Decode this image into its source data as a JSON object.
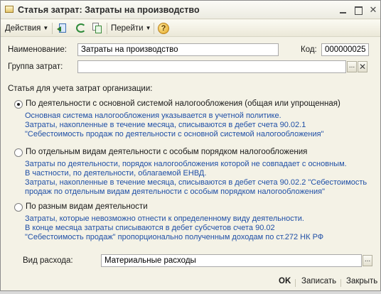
{
  "window": {
    "title": "Статья затрат: Затраты на производство"
  },
  "toolbar": {
    "actions_label": "Действия",
    "goto_label": "Перейти",
    "help_symbol": "?"
  },
  "form": {
    "name_label": "Наименование:",
    "name_value": "Затраты на производство",
    "code_label": "Код:",
    "code_value": "000000025",
    "group_label": "Группа затрат:",
    "group_value": "",
    "section_label": "Статья для учета затрат организации:",
    "select_button": "...",
    "clear_button": "✕"
  },
  "options": [
    {
      "label": "По деятельности с основной системой налогообложения (общая или упрощенная)",
      "selected": true,
      "description": [
        "Основная система налогообложения указывается в учетной политике.",
        "Затраты, накопленные в течение месяца, списываются в дебет счета 90.02.1",
        "\"Себестоимость продаж по деятельности с основной системой налогообложения\""
      ]
    },
    {
      "label": "По отдельным видам деятельности с особым порядком налогообложения",
      "selected": false,
      "description": [
        "Затраты по деятельности, порядок налогообложения которой не совпадает с основным.",
        "В частности, по деятельности, облагаемой ЕНВД.",
        "Затраты, накопленные в течение месяца, списываются в дебет счета 90.02.2 \"Себестоимость",
        "продаж по отдельным видам деятельности с особым порядком налогообложения\""
      ]
    },
    {
      "label": "По разным видам деятельности",
      "selected": false,
      "description": [
        "Затраты, которые невозможно отнести к определенному виду деятельности.",
        "В конце месяца затраты списываются в дебет субсчетов счета 90.02",
        "\"Себестоимость продаж\" пропорционально полученным доходам по ст.272 НК РФ"
      ]
    }
  ],
  "expense": {
    "label": "Вид расхода:",
    "value": "Материальные расходы"
  },
  "footer": {
    "ok_label": "OK",
    "save_label": "Записать",
    "close_label": "Закрыть"
  }
}
